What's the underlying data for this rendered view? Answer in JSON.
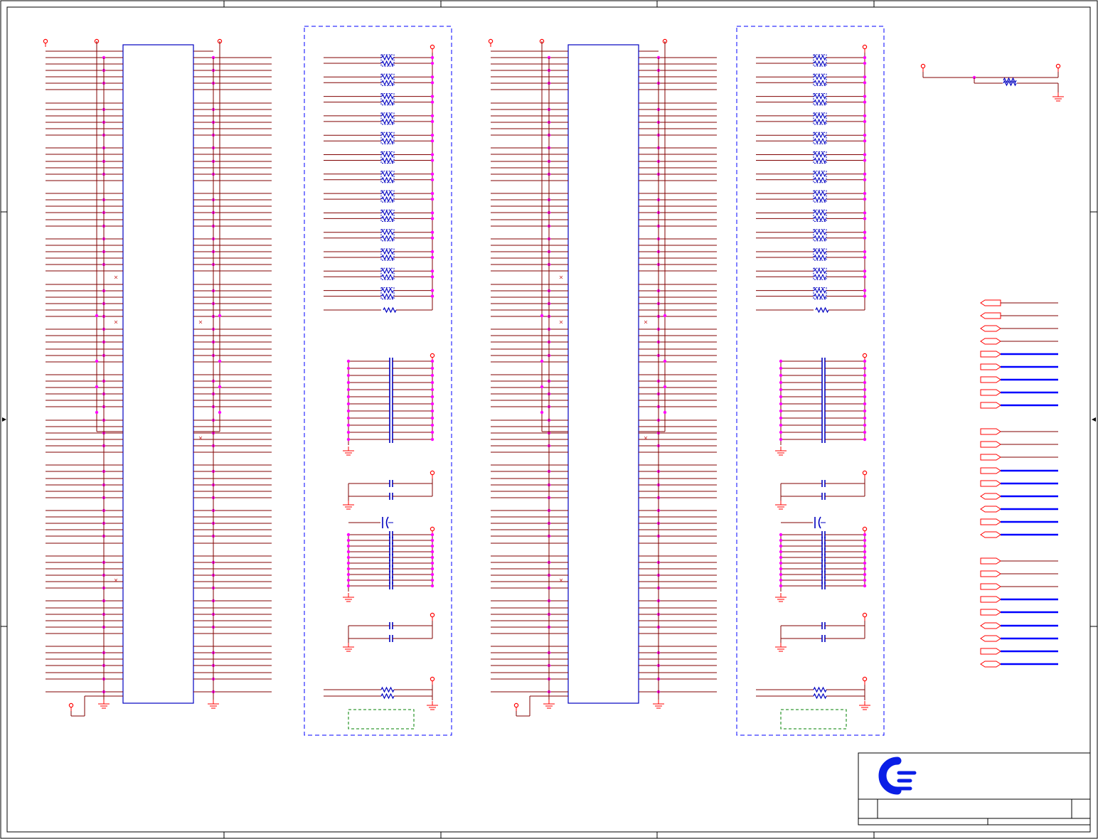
{
  "sheet": {
    "kind": "schematic",
    "zones": {
      "columns": 5,
      "rows": 4
    },
    "colors": {
      "frame": "#000000",
      "wire": "#800000",
      "component": "#0000c0",
      "junction": "#ff00ff",
      "power": "#ff0000",
      "port": "#ff0000",
      "bus": "#0000ff",
      "noconnect": "#cc3333",
      "group_box": "#0000ff",
      "note_box": "#008000",
      "logo": "#0a1ee6"
    },
    "icons": [
      "power-flag-icon",
      "ground-icon",
      "resistor-icon",
      "resistor-pack-icon",
      "capacitor-icon",
      "port-icon",
      "logo-icon"
    ]
  },
  "connectors": [
    {
      "name": "connector-left"
    },
    {
      "name": "connector-right"
    }
  ],
  "networks": [
    {
      "name": "network-left",
      "resistor_packs": 13,
      "decoupling_caps": 12
    },
    {
      "name": "network-right",
      "resistor_packs": 13,
      "decoupling_caps": 12
    }
  ],
  "ports": {
    "group1": 9,
    "group2": 9,
    "group3": 9
  },
  "title_block": {
    "logo": "logo-icon"
  }
}
